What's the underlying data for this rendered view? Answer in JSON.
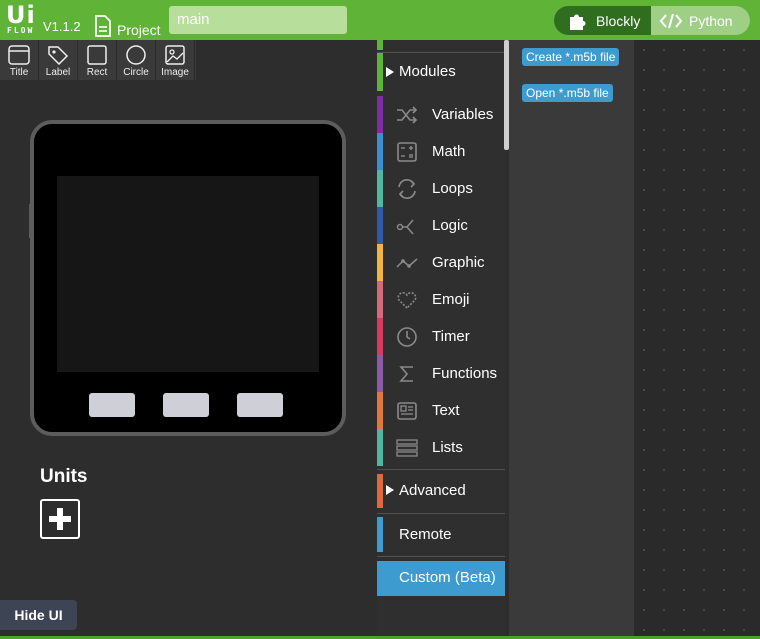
{
  "app": {
    "logo_text": "Ui",
    "logo_sub": "FLOW",
    "version": "V1.1.2",
    "project_label": "Project",
    "project_name": "main"
  },
  "mode_toggle": {
    "blockly_label": "Blockly",
    "python_label": "Python"
  },
  "tools": [
    {
      "label": "Title",
      "icon": "title-icon"
    },
    {
      "label": "Label",
      "icon": "label-tag-icon"
    },
    {
      "label": "Rect",
      "icon": "rect-icon"
    },
    {
      "label": "Circle",
      "icon": "circle-icon"
    },
    {
      "label": "Image",
      "icon": "image-icon"
    }
  ],
  "units": {
    "title": "Units"
  },
  "hide_ui_label": "Hide UI",
  "categories": {
    "modules": "Modules",
    "items": [
      {
        "label": "Variables",
        "color": "#7b2fa2",
        "icon": "shuffle-icon"
      },
      {
        "label": "Math",
        "color": "#3a8fd1",
        "icon": "calculator-icon"
      },
      {
        "label": "Loops",
        "color": "#4fb8a0",
        "icon": "loop-arrows-icon"
      },
      {
        "label": "Logic",
        "color": "#2e5aa8",
        "icon": "branch-icon"
      },
      {
        "label": "Graphic",
        "color": "#f0b444",
        "icon": "graph-line-icon"
      },
      {
        "label": "Emoji",
        "color": "#d46a7a",
        "icon": "heart-icon"
      },
      {
        "label": "Timer",
        "color": "#d63a5e",
        "icon": "clock-icon"
      },
      {
        "label": "Functions",
        "color": "#8b5ba6",
        "icon": "sigma-icon"
      },
      {
        "label": "Text",
        "color": "#e0783a",
        "icon": "text-card-icon"
      },
      {
        "label": "Lists",
        "color": "#4db8a0",
        "icon": "list-icon"
      }
    ],
    "advanced": "Advanced",
    "remote": "Remote",
    "custom": "Custom (Beta)"
  },
  "flyout": {
    "create_label": "Create *.m5b file",
    "open_label": "Open *.m5b file"
  }
}
